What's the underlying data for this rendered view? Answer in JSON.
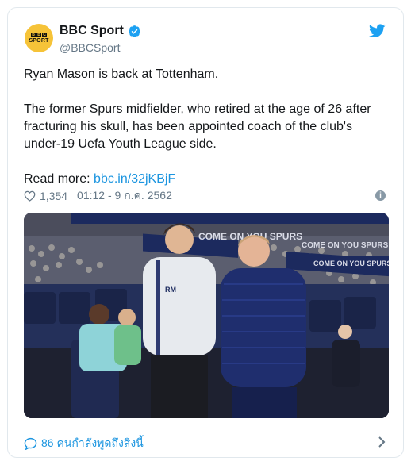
{
  "tweet": {
    "author_name": "BBC Sport",
    "author_handle": "@BBCSport",
    "avatar_lines": [
      "B",
      "B",
      "C",
      "SPORT"
    ],
    "paragraph_1": "Ryan Mason is back at Tottenham.",
    "paragraph_2": "The former Spurs midfielder, who retired at the age of 26 after fracturing his skull, has been appointed coach of the club's under-19 Uefa Youth League side.",
    "read_more_label": "Read more:",
    "read_more_link": "bbc.in/32jKBjF",
    "likes": "1,354",
    "timestamp": "01:12 - 9 ก.ค. 2562",
    "info_glyph": "i",
    "photo": {
      "banner_texts": [
        "COME ON YOU SPURS",
        "COME ON YOU SPURS",
        "COME ON YOU SPURS"
      ],
      "jacket_initials": "RM"
    },
    "footer_text": "86 คนกำลังพูดถึงสิ่งนี้"
  },
  "colors": {
    "accent": "#1b95e0",
    "verified": "#1da1f2",
    "avatar_bg": "#f6c338",
    "muted": "#657786"
  },
  "icons": [
    "bbc-sport-avatar",
    "verified-icon",
    "twitter-bird-icon",
    "heart-icon",
    "info-icon",
    "speech-bubble-icon",
    "chevron-right-icon"
  ]
}
